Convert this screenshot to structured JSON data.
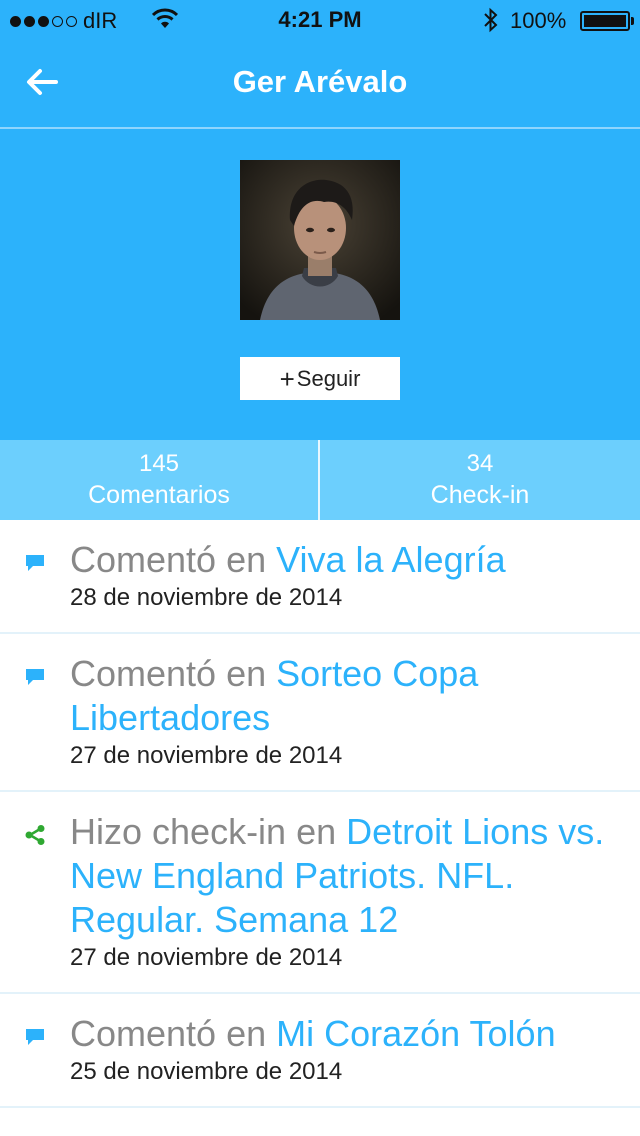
{
  "status_bar": {
    "carrier": "dIR",
    "time": "4:21 PM",
    "battery": "100%"
  },
  "header": {
    "title": "Ger Arévalo"
  },
  "profile": {
    "follow_label": "Seguir",
    "follow_plus": "+"
  },
  "stats": [
    {
      "value": "145",
      "label": "Comentarios"
    },
    {
      "value": "34",
      "label": "Check-in"
    }
  ],
  "feed": [
    {
      "icon": "comment-icon",
      "prefix": "Comentó en ",
      "link": "Viva la Alegría",
      "date": "28 de noviembre de 2014"
    },
    {
      "icon": "comment-icon",
      "prefix": "Comentó en ",
      "link": "Sorteo Copa Libertadores",
      "date": "27 de noviembre de 2014"
    },
    {
      "icon": "share-icon",
      "prefix": "Hizo check-in en ",
      "link": "Detroit Lions vs. New England Patriots. NFL. Regular. Semana 12",
      "date": "27 de noviembre de 2014"
    },
    {
      "icon": "comment-icon",
      "prefix": "Comentó en ",
      "link": "Mi Corazón Tolón",
      "date": "25 de noviembre de 2014"
    }
  ],
  "colors": {
    "accent": "#2cb2fb",
    "stats_bar": "#6ccffd",
    "checkin_icon": "#2fa832"
  }
}
